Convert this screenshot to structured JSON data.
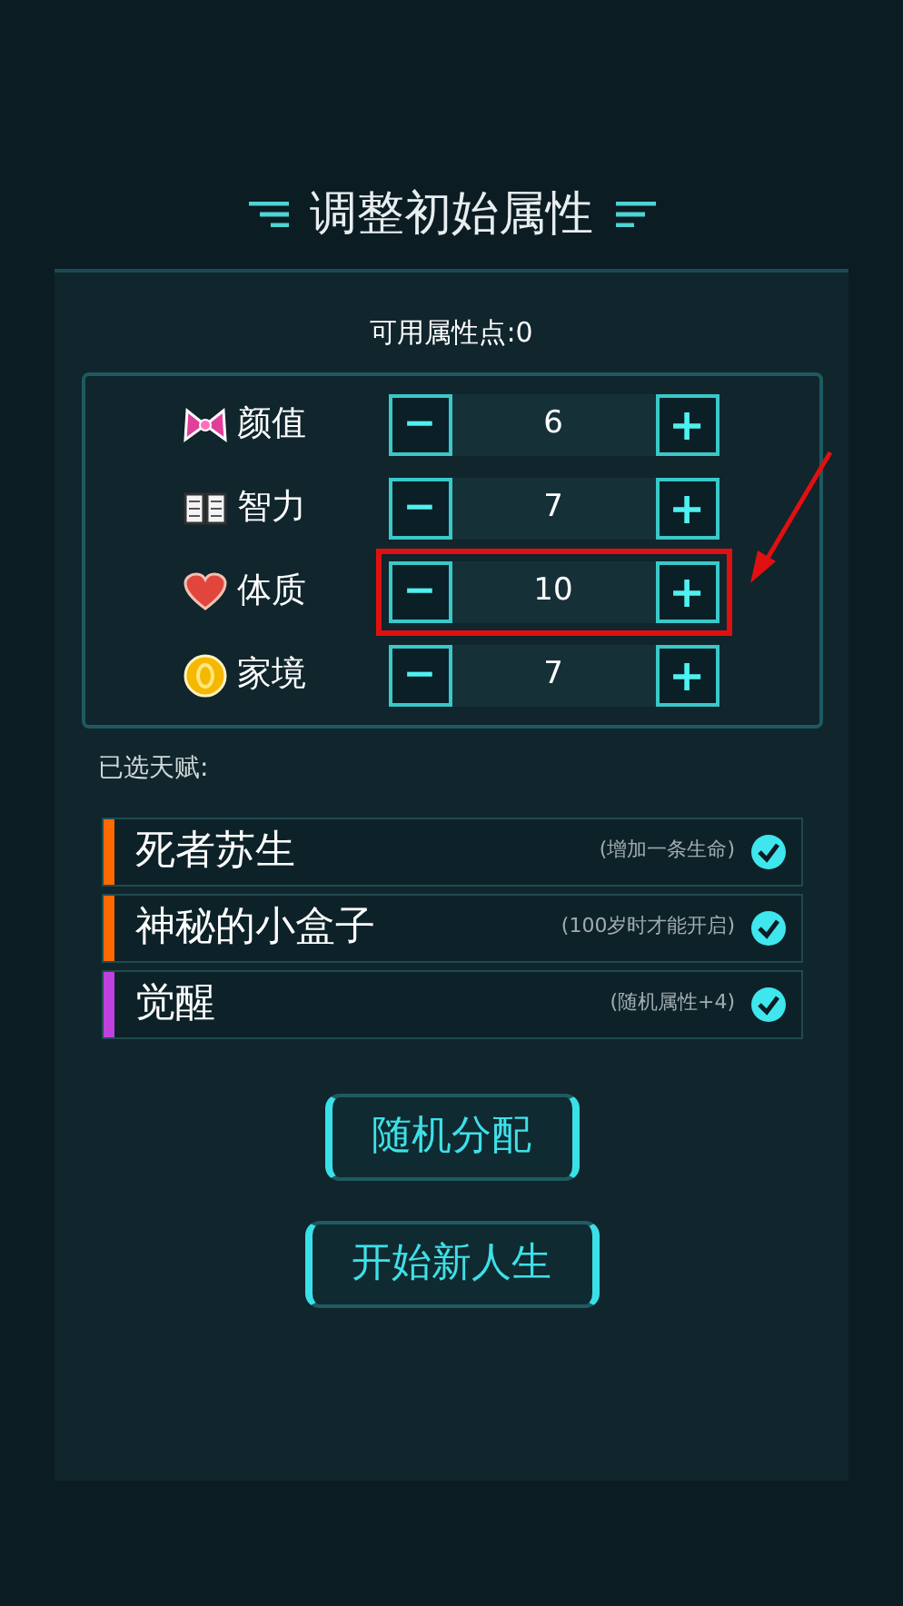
{
  "title": "调整初始属性",
  "points": "可用属性点:0",
  "stats": [
    {
      "label": "颜值",
      "value": "6",
      "minus": "−",
      "plus": "+",
      "highlighted": false
    },
    {
      "label": "智力",
      "value": "7",
      "minus": "−",
      "plus": "+",
      "highlighted": false
    },
    {
      "label": "体质",
      "value": "10",
      "minus": "−",
      "plus": "+",
      "highlighted": true
    },
    {
      "label": "家境",
      "value": "7",
      "minus": "−",
      "plus": "+",
      "highlighted": false
    }
  ],
  "talents_heading": "已选天赋:",
  "talents": [
    {
      "name": "死者苏生",
      "note": "(增加一条生命)",
      "color": "#ff6a00",
      "checked": true
    },
    {
      "name": "神秘的小盒子",
      "note": "(100岁时才能开启)",
      "color": "#ff6a00",
      "checked": true
    },
    {
      "name": "觉醒",
      "note": "(随机属性+4)",
      "color": "#c040e0",
      "checked": true
    }
  ],
  "buttons": [
    "随机分配",
    "开始新人生"
  ]
}
